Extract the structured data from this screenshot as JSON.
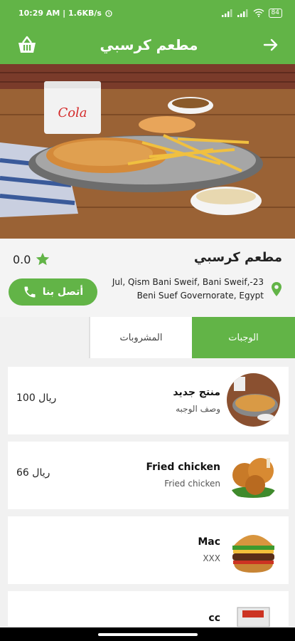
{
  "status_bar": {
    "time_speed": "10:29 AM | 1.6KB/s",
    "battery": "84"
  },
  "app_bar": {
    "title": "مطعم كرسبي",
    "left_icon": "basket-icon",
    "right_icon": "arrow-right-icon"
  },
  "hero": {
    "description_icon": "food-photo"
  },
  "restaurant": {
    "name": "مطعم كرسبي",
    "rating": "0.0",
    "address": "Jul, Qism Bani Sweif, Bani Sweif,-23 Beni Suef Governorate, Egypt",
    "contact_label": "أتصل بنا"
  },
  "tabs": [
    {
      "label": "المشروبات",
      "active": false
    },
    {
      "label": "الوجبات",
      "active": true
    }
  ],
  "items": [
    {
      "name": "منتج جديد",
      "desc": "وصف الوجبه",
      "price": "100 ريال"
    },
    {
      "name": "Fried chicken",
      "desc": "Fried chicken",
      "price": "66 ريال"
    },
    {
      "name": "Mac",
      "desc": "XXX",
      "price": ""
    },
    {
      "name": "cc",
      "desc": "",
      "price": ""
    }
  ],
  "colors": {
    "primary": "#62b447",
    "background": "#f1f1f1"
  }
}
